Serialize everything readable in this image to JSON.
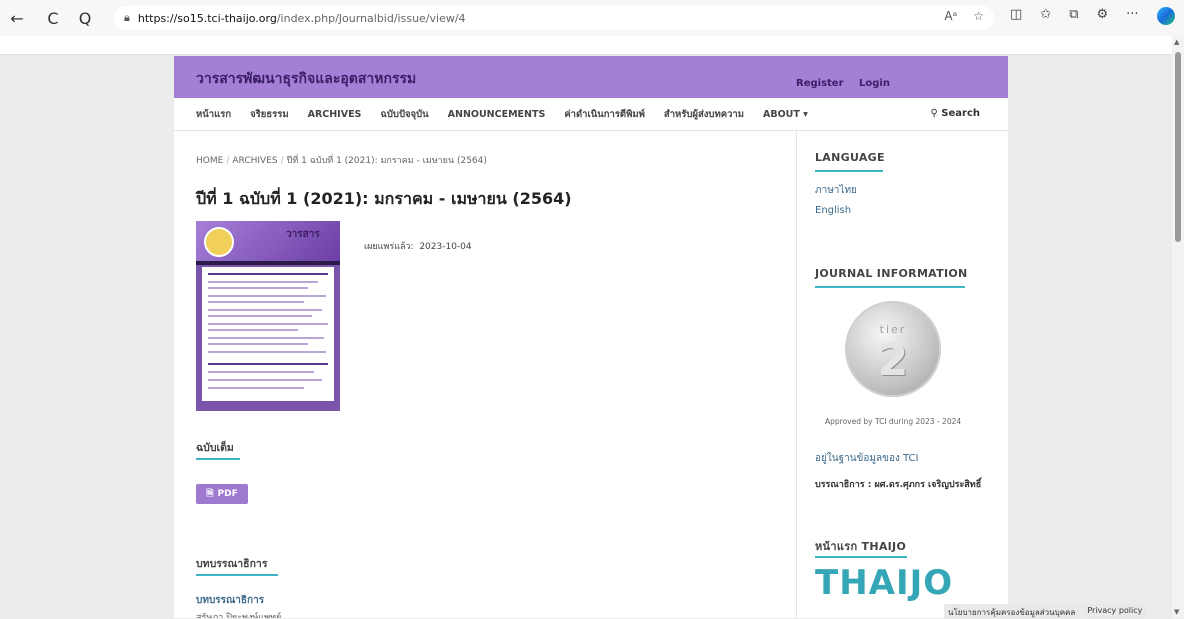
{
  "browser": {
    "url_host": "https://so15.tci-thaijo.org",
    "url_path": "/index.php/Journalbid/issue/view/4",
    "reader_icon": "Aᵃ",
    "back_icon": "←",
    "reload_icon": "C",
    "search_icon": "Q",
    "more_icon": "···"
  },
  "header": {
    "site_title": "วารสารพัฒนาธุรกิจและอุตสาหกรรม",
    "register": "Register",
    "login": "Login"
  },
  "nav": {
    "items": [
      "หน้าแรก",
      "จริยธรรม",
      "ARCHIVES",
      "ฉบับปัจจุบัน",
      "ANNOUNCEMENTS",
      "ค่าดำเนินการตีพิมพ์",
      "สำหรับผู้ส่งบทความ",
      "ABOUT ▾"
    ],
    "search": "Search"
  },
  "breadcrumb": {
    "home": "HOME",
    "archives": "ARCHIVES",
    "current": "ปีที่ 1 ฉบับที่ 1 (2021): มกราคม - เมษายน (2564)"
  },
  "issue": {
    "title": "ปีที่ 1 ฉบับที่ 1 (2021): มกราคม - เมษายน (2564)",
    "published_label": "เผยแพร่แล้ว:",
    "published_date": "2023-10-04",
    "cover_title": "วารสาร"
  },
  "sections": {
    "full_issue": "ฉบับเต็ม",
    "pdf": "PDF",
    "editorial": "บทบรรณาธิการ",
    "article_title": "บทบรรณาธิการ",
    "article_author": "สุรัษฎา ปิยะพงษ์แพทย์"
  },
  "sidebar": {
    "language_heading": "LANGUAGE",
    "lang_thai": "ภาษาไทย",
    "lang_en": "English",
    "journal_info_heading": "JOURNAL INFORMATION",
    "tier_word": "tier",
    "tier_num": "2",
    "tci_caption": "Approved by TCI during 2023 - 2024",
    "tci_db": "อยู่ในฐานข้อมูลของ TCI",
    "editor": "บรรณาธิการ : ผศ.ดร.ศุภกร เจริญประสิทธิ์",
    "thaijo_heading": "หน้าแรก THAIJO",
    "thaijo_logo": "THAIJO"
  },
  "footer": {
    "privacy_th": "นโยบายการคุ้มครองข้อมูลส่วนบุคคล",
    "privacy_en": "Privacy policy"
  }
}
